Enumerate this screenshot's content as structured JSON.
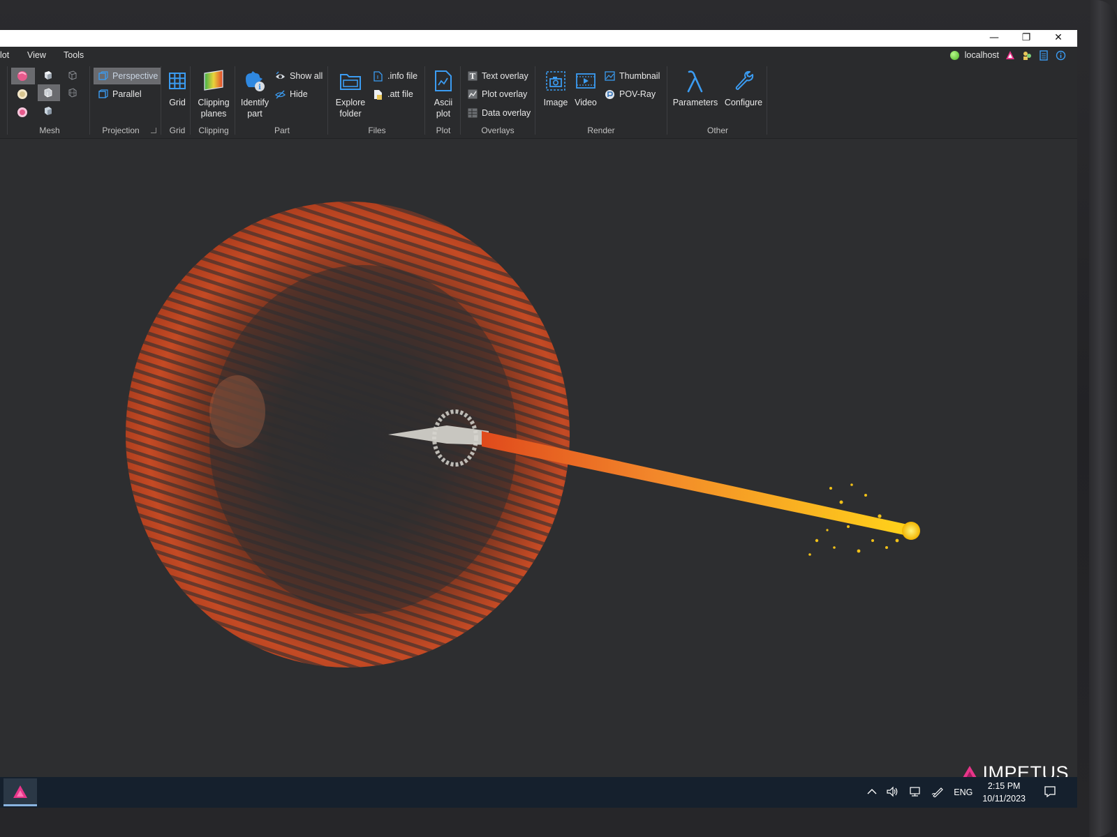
{
  "window": {
    "controls": {
      "minimize": "—",
      "restore": "❐",
      "close": "✕"
    }
  },
  "menu": {
    "items": [
      "lot",
      "View",
      "Tools"
    ]
  },
  "status": {
    "server_label": "localhost",
    "server_status_color": "#4cb424"
  },
  "ribbon": {
    "groups": {
      "mesh": "Mesh",
      "projection": "Projection",
      "grid": "Grid",
      "clipping": "Clipping",
      "part": "Part",
      "files": "Files",
      "plot": "Plot",
      "overlays": "Overlays",
      "render": "Render",
      "other": "Other"
    },
    "projection": {
      "perspective": "Perspective",
      "parallel": "Parallel"
    },
    "grid": {
      "grid": "Grid"
    },
    "clipping": {
      "line1": "Clipping",
      "line2": "planes"
    },
    "part": {
      "identify_line1": "Identify",
      "identify_line2": "part",
      "show_all": "Show all",
      "hide": "Hide"
    },
    "files": {
      "explore_line1": "Explore",
      "explore_line2": "folder",
      "info_file": ".info file",
      "att_file": ".att file"
    },
    "plot": {
      "ascii_line1": "Ascii",
      "ascii_line2": "plot"
    },
    "overlays": {
      "text": "Text overlay",
      "plot": "Plot overlay",
      "data": "Data overlay"
    },
    "render": {
      "image": "Image",
      "video": "Video",
      "thumbnail": "Thumbnail",
      "povray": "POV-Ray"
    },
    "other": {
      "parameters": "Parameters",
      "configure": "Configure"
    }
  },
  "viewport": {
    "logo_text": "IMPETUS",
    "accent_color": "#e8358a"
  },
  "taskbar": {
    "language": "ENG",
    "time": "2:15 PM",
    "date": "10/11/2023"
  },
  "colors": {
    "ribbon_icon_blue": "#3b9cf2",
    "ribbon_bg": "#2a2b2d",
    "viewport_bg": "#2d2e30",
    "taskbar_bg": "#15202d"
  }
}
